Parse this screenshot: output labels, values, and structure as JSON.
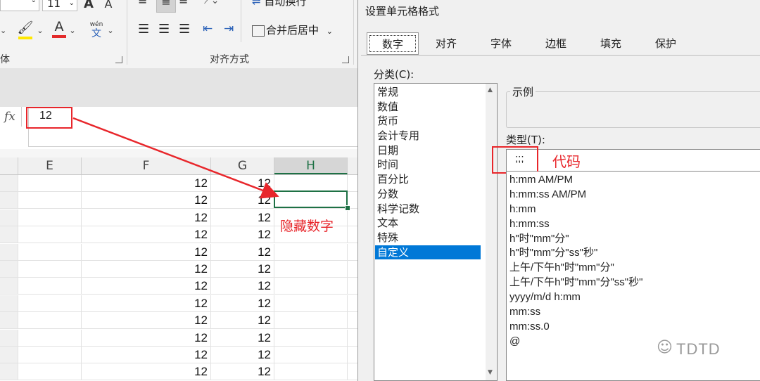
{
  "excel": {
    "ribbon": {
      "font_size_value": "11",
      "bold_label": "A",
      "italic_label": "A",
      "wrap_text_label": "自动换行",
      "merge_center_label": "合并后居中",
      "phonetic_label_top": "wén",
      "phonetic_label_bottom": "文",
      "font_group_label": "体",
      "align_group_label": "对齐方式",
      "fill_color": "#ffe800",
      "font_color": "#e32b2b"
    },
    "formula_bar": {
      "fx_label": "fx",
      "value": "12"
    },
    "columns": [
      "E",
      "F",
      "G",
      "H"
    ],
    "rows": [
      {
        "F": "12",
        "G": "12"
      },
      {
        "F": "12",
        "G": "12"
      },
      {
        "F": "12",
        "G": "12"
      },
      {
        "F": "12",
        "G": "12"
      },
      {
        "F": "12",
        "G": "12"
      },
      {
        "F": "12",
        "G": "12"
      },
      {
        "F": "12",
        "G": "12"
      },
      {
        "F": "12",
        "G": "12"
      },
      {
        "F": "12",
        "G": "12"
      },
      {
        "F": "12",
        "G": "12"
      },
      {
        "F": "12",
        "G": "12"
      },
      {
        "F": "12",
        "G": "12"
      }
    ],
    "annotation_hidden": "隐藏数字"
  },
  "dialog": {
    "title": "设置单元格格式",
    "tabs": [
      "数字",
      "对齐",
      "字体",
      "边框",
      "填充",
      "保护"
    ],
    "active_tab": "数字",
    "category_label": "分类(C):",
    "categories": [
      "常规",
      "数值",
      "货币",
      "会计专用",
      "日期",
      "时间",
      "百分比",
      "分数",
      "科学记数",
      "文本",
      "特殊",
      "自定义"
    ],
    "selected_category": "自定义",
    "sample_label": "示例",
    "type_label": "类型(T):",
    "type_value": ";;;",
    "annotation_code": "代码",
    "type_list": [
      "h:mm AM/PM",
      "h:mm:ss AM/PM",
      "h:mm",
      "h:mm:ss",
      "h\"时\"mm\"分\"",
      "h\"时\"mm\"分\"ss\"秒\"",
      "上午/下午h\"时\"mm\"分\"",
      "上午/下午h\"时\"mm\"分\"ss\"秒\"",
      "yyyy/m/d h:mm",
      "mm:ss",
      "mm:ss.0",
      "@"
    ],
    "selection_color": "#0078d7",
    "annotation_color": "#e8262b"
  },
  "watermark": "TDTD"
}
